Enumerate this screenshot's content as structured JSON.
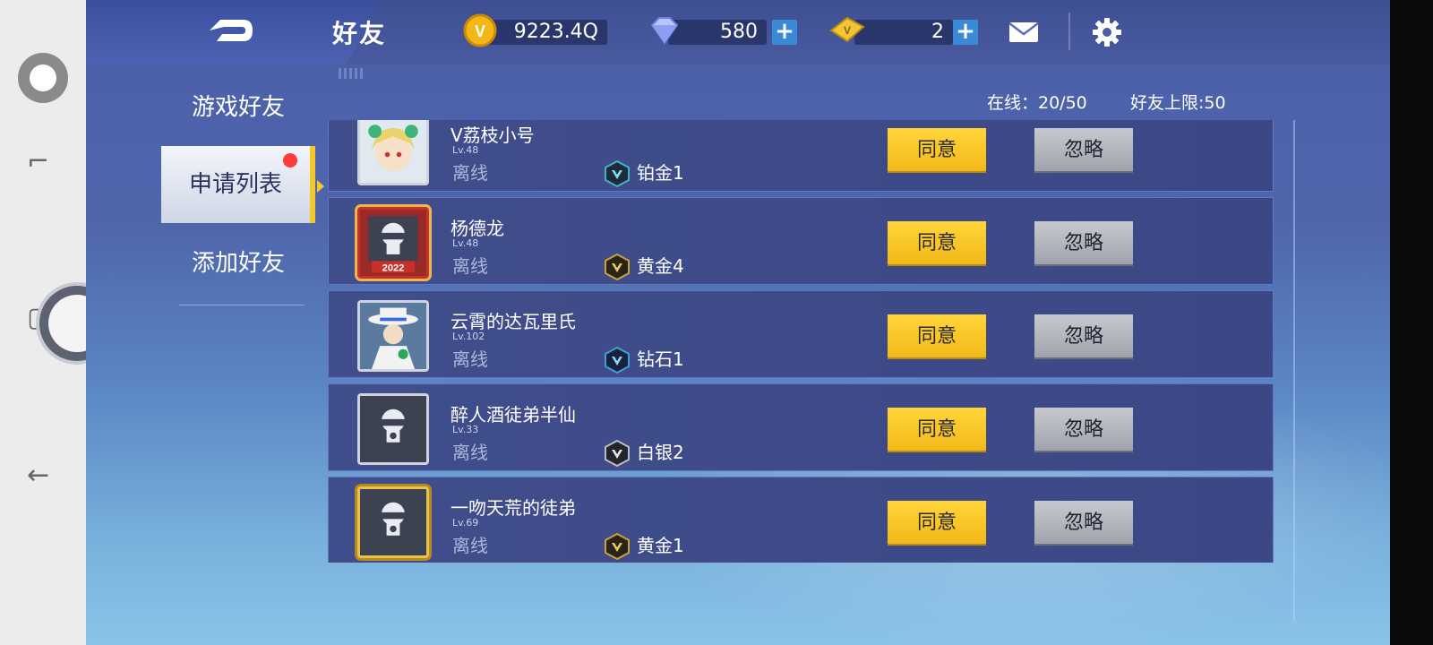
{
  "header": {
    "title": "好友",
    "coins": "9223.4Q",
    "diamonds": "580",
    "tickets": "2"
  },
  "tabs": [
    {
      "label": "游戏好友",
      "active": false
    },
    {
      "label": "申请列表",
      "active": true,
      "has_notification": true
    },
    {
      "label": "添加好友",
      "active": false
    }
  ],
  "status": {
    "online_label": "在线：20/50",
    "limit_label": "好友上限:50"
  },
  "buttons": {
    "agree": "同意",
    "ignore": "忽略"
  },
  "requests": [
    {
      "name": "V荔枝小号",
      "level": "Lv.48",
      "state": "离线",
      "rank": "铂金1",
      "rank_color": "#3fb4c8",
      "avatar": "anime-girl",
      "frame": "plain"
    },
    {
      "name": "杨德龙",
      "level": "Lv.48",
      "state": "离线",
      "rank": "黄金4",
      "rank_color": "#c9a23a",
      "avatar": "gas-mask",
      "frame": "red-2022"
    },
    {
      "name": "云霄的达瓦里氏",
      "level": "Lv.102",
      "state": "离线",
      "rank": "钻石1",
      "rank_color": "#3aa0e0",
      "avatar": "white-hat-character",
      "frame": "plain"
    },
    {
      "name": "醉人酒徒弟半仙",
      "level": "Lv.33",
      "state": "离线",
      "rank": "白银2",
      "rank_color": "#b8bcc6",
      "avatar": "gas-mask",
      "frame": "plain"
    },
    {
      "name": "一吻天荒的徒弟",
      "level": "Lv.69",
      "state": "离线",
      "rank": "黄金1",
      "rank_color": "#c9a23a",
      "avatar": "gas-mask",
      "frame": "gold"
    }
  ],
  "icons": {
    "back": "back-arrow-icon",
    "coin": "coin-icon",
    "diamond": "diamond-icon",
    "ticket": "ticket-icon",
    "mail": "mail-icon",
    "settings": "gear-icon"
  }
}
